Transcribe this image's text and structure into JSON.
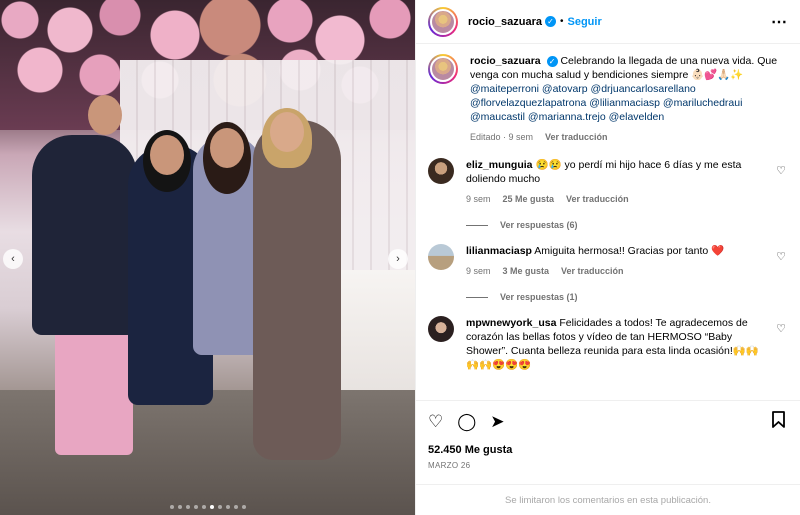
{
  "header": {
    "username": "rocio_sazuara",
    "separator": "•",
    "follow_label": "Seguir",
    "more_icon": "⋯"
  },
  "caption": {
    "username": "rocio_sazuara",
    "text": "Celebrando la llegada de una nueva vida. Que venga con mucha salud y bendiciones siempre 👶🏻💕🙏🏻✨",
    "mentions": "@maiteperroni @atovarp @drjuancarlosarellano @florvelazquezlapatrona @lilianmaciasp @mariluchedraui @maucastil @marianna.trejo @elavelden",
    "edited": "Editado · 9 sem",
    "translate": "Ver traducción"
  },
  "comments": [
    {
      "username": "eliz_munguia",
      "text": "😢😢 yo perdí mi hijo hace 6 días y me esta doliendo mucho",
      "age": "9 sem",
      "likes": "25 Me gusta",
      "translate": "Ver traducción",
      "replies": "Ver respuestas (6)"
    },
    {
      "username": "lilianmaciasp",
      "text": "Amiguita hermosa!! Gracias por tanto ❤️",
      "age": "9 sem",
      "likes": "3 Me gusta",
      "translate": "Ver traducción",
      "replies": "Ver respuestas (1)"
    },
    {
      "username": "mpwnewyork_usa",
      "text": "Felicidades a todos! Te agradecemos de corazón las bellas fotos y vídeo de tan HERMOSO “Baby Shower”. Cuanta belleza reunida para esta linda ocasión!🙌🙌🙌🙌😍😍😍"
    }
  ],
  "actions": {
    "like_icon": "♡",
    "comment_icon": "◯",
    "share_icon": "➤",
    "save_icon": "🔖"
  },
  "likes_count": "52.450 Me gusta",
  "post_date": "MARZO 26",
  "comments_disabled": "Se limitaron los comentarios en esta publicación.",
  "carousel": {
    "prev_icon": "‹",
    "next_icon": "›",
    "dots_total": 10,
    "active_dot": 5
  }
}
